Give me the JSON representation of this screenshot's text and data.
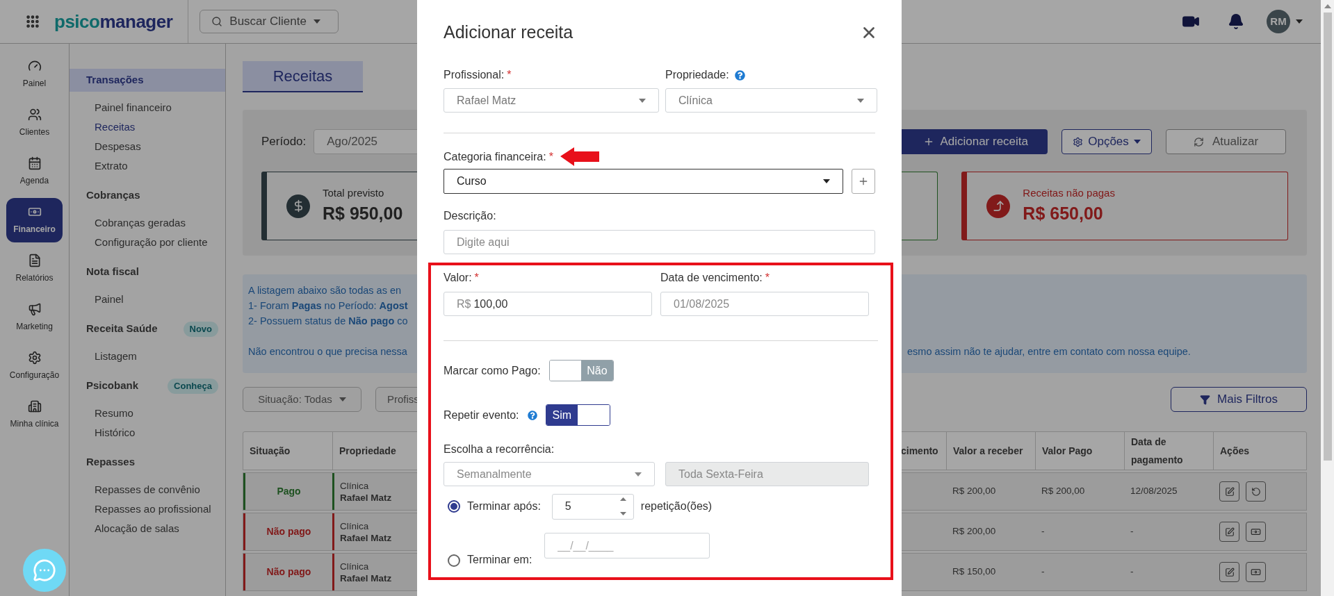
{
  "topbar": {
    "logo": {
      "accent": "psico",
      "rest": "manager"
    },
    "search_button": "Buscar Cliente",
    "avatar": "RM"
  },
  "sidebar": [
    {
      "label": "Painel",
      "selected": false
    },
    {
      "label": "Clientes",
      "selected": false
    },
    {
      "label": "Agenda",
      "selected": false
    },
    {
      "label": "Financeiro",
      "selected": true
    },
    {
      "label": "Relatórios",
      "selected": false
    },
    {
      "label": "Marketing",
      "selected": false
    },
    {
      "label": "Configuração",
      "selected": false
    },
    {
      "label": "Minha clínica",
      "selected": false
    }
  ],
  "submenu": [
    {
      "title": "Transações",
      "selected": true,
      "items": [
        {
          "label": "Painel financeiro",
          "selected": false
        },
        {
          "label": "Receitas",
          "selected": true
        },
        {
          "label": "Despesas",
          "selected": false
        },
        {
          "label": "Extrato",
          "selected": false
        }
      ]
    },
    {
      "title": "Cobranças",
      "selected": false,
      "items": [
        {
          "label": "Cobranças geradas",
          "selected": false
        },
        {
          "label": "Configuração por cliente",
          "selected": false
        }
      ]
    },
    {
      "title": "Nota fiscal",
      "selected": false,
      "items": [
        {
          "label": "Painel",
          "selected": false
        }
      ]
    },
    {
      "title": "Receita Saúde",
      "selected": false,
      "badge": "Novo",
      "items": [
        {
          "label": "Listagem",
          "selected": false
        }
      ]
    },
    {
      "title": "Psicobank",
      "selected": false,
      "badge": "Conheça",
      "items": [
        {
          "label": "Resumo",
          "selected": false
        },
        {
          "label": "Histórico",
          "selected": false
        }
      ]
    },
    {
      "title": "Repasses",
      "selected": false,
      "items": [
        {
          "label": "Repasses de convênio",
          "selected": false
        },
        {
          "label": "Repasses ao profissional",
          "selected": false
        },
        {
          "label": "Alocação de salas",
          "selected": false
        }
      ]
    }
  ],
  "page": {
    "tab": "Receitas",
    "period": {
      "label": "Período:",
      "value": "Ago/2025"
    },
    "buttons": {
      "add": "Adicionar receita",
      "options": "Opções",
      "refresh": "Atualizar"
    },
    "cards": [
      {
        "title": "Total previsto",
        "value": "R$ 950,00",
        "kind": "total"
      },
      {
        "kind": "paid"
      },
      {
        "title": "Receitas não pagas",
        "value": "R$ 650,00",
        "kind": "unpaid"
      }
    ],
    "info": {
      "lines": [
        "A listagem abaixo são todas as en",
        "1- Foram **Pagas** no Período: **Agost**",
        "2- Possuem status de **Não pago** co"
      ],
      "last_line": "Não encontrou o que precisa nessa",
      "last_line_end": "esmo assim não te ajudar, entre em contato com nossa equipe."
    },
    "filters": {
      "situation": "Situação: Todas",
      "professional": "Profiss",
      "more": "Mais Filtros"
    },
    "table": {
      "columns": [
        "Situação",
        "Propriedade",
        "cimento",
        "Valor a receber",
        "Valor Pago",
        "Data de pagamento",
        "Ações"
      ],
      "rows": [
        {
          "status": "Pago",
          "kind": "paid",
          "property": "Clínica",
          "professional": "Rafael Matz",
          "amount": "R$ 200,00",
          "paid_amount": "R$ 200,00",
          "paid_date": "12/08/2025"
        },
        {
          "status": "Não pago",
          "kind": "unpaid",
          "property": "Clínica",
          "professional": "Rafael Matz",
          "amount": "R$ 200,00",
          "paid_amount": "-",
          "paid_date": "-"
        },
        {
          "status": "Não pago",
          "kind": "unpaid",
          "property": "Clínica",
          "professional": "Rafael Matz",
          "amount": "R$ 150,00",
          "paid_amount": "-",
          "paid_date": "-"
        }
      ]
    }
  },
  "modal": {
    "title": "Adicionar receita",
    "professional": {
      "label": "Profissional:",
      "mark": "*",
      "value": "Rafael Matz"
    },
    "property": {
      "label": "Propriedade:",
      "value": "Clínica"
    },
    "category": {
      "label": "Categoria financeira:",
      "mark": "*",
      "value": "Curso"
    },
    "description": {
      "label": "Descrição:",
      "placeholder": "Digite aqui"
    },
    "amount": {
      "label": "Valor:",
      "mark": "*",
      "prefix": "R$",
      "value": "100,00"
    },
    "due_date": {
      "label": "Data de vencimento:",
      "mark": "*",
      "value": "01/08/2025"
    },
    "mark_paid": {
      "label": "Marcar como Pago:",
      "on": false,
      "state_text": "Não"
    },
    "repeat": {
      "label": "Repetir evento:",
      "on": true,
      "state_text": "Sim"
    },
    "recurrence": {
      "label": "Escolha a recorrência:",
      "value": "Semanalmente",
      "day": "Toda Sexta-Feira"
    },
    "end_options": [
      {
        "label": "Terminar após:",
        "selected": true,
        "kind": "count",
        "value": "5",
        "suffix": "repetição(ões)"
      },
      {
        "label": "Terminar em:",
        "selected": false,
        "kind": "date",
        "placeholder": "__/__/____"
      }
    ]
  }
}
